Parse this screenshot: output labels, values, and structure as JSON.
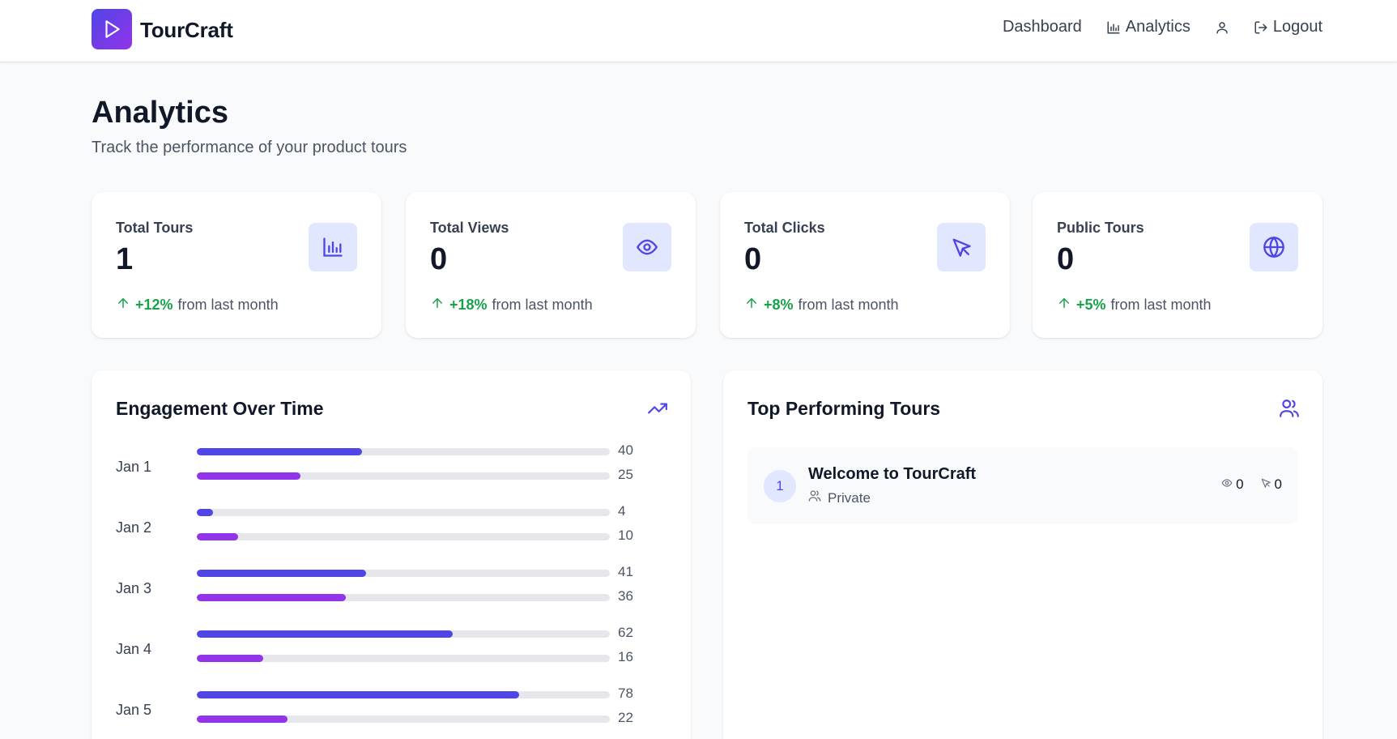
{
  "brand": {
    "name": "TourCraft"
  },
  "nav": {
    "dashboard": "Dashboard",
    "analytics": "Analytics",
    "logout": "Logout"
  },
  "page": {
    "title": "Analytics",
    "subtitle": "Track the performance of your product tours"
  },
  "stats": [
    {
      "label": "Total Tours",
      "value": "1",
      "change": "+12%",
      "suffix": "from last month",
      "icon": "bar-chart-icon"
    },
    {
      "label": "Total Views",
      "value": "0",
      "change": "+18%",
      "suffix": "from last month",
      "icon": "eye-icon"
    },
    {
      "label": "Total Clicks",
      "value": "0",
      "change": "+8%",
      "suffix": "from last month",
      "icon": "pointer-icon"
    },
    {
      "label": "Public Tours",
      "value": "0",
      "change": "+5%",
      "suffix": "from last month",
      "icon": "globe-icon"
    }
  ],
  "engagement": {
    "title": "Engagement Over Time",
    "icon": "trending-up-icon",
    "days": [
      {
        "label": "Jan 1",
        "views": 40,
        "clicks": 25,
        "views_text": "40",
        "clicks_text": "25"
      },
      {
        "label": "Jan 2",
        "views": 4,
        "clicks": 10,
        "views_text": "4",
        "clicks_text": "10"
      },
      {
        "label": "Jan 3",
        "views": 41,
        "clicks": 36,
        "views_text": "41",
        "clicks_text": "36"
      },
      {
        "label": "Jan 4",
        "views": 62,
        "clicks": 16,
        "views_text": "62",
        "clicks_text": "16"
      },
      {
        "label": "Jan 5",
        "views": 78,
        "clicks": 22,
        "views_text": "78",
        "clicks_text": "22"
      }
    ],
    "max": 100
  },
  "top_tours": {
    "title": "Top Performing Tours",
    "icon": "users-icon",
    "items": [
      {
        "rank": "1",
        "name": "Welcome to TourCraft",
        "visibility": "Private",
        "views": "0",
        "clicks": "0"
      }
    ]
  },
  "colors": {
    "accent": "#4f46e5",
    "purple": "#9333ea",
    "accent_light": "#e0e7ff",
    "positive": "#16a34a"
  }
}
